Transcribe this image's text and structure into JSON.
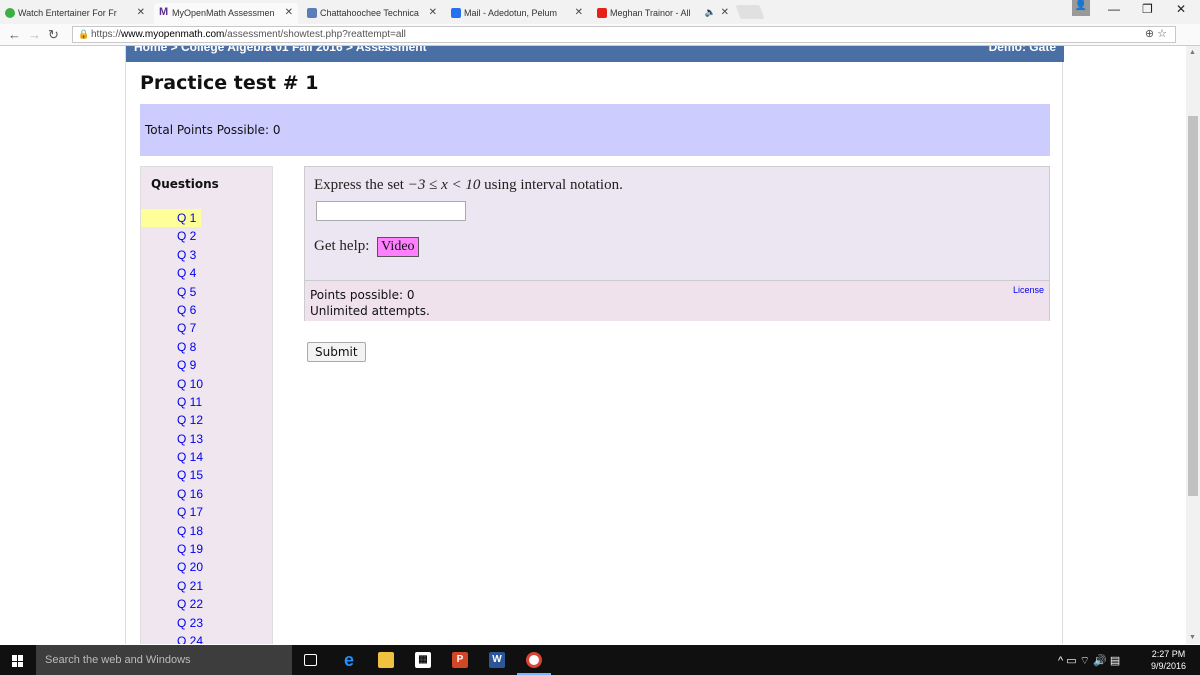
{
  "browser": {
    "tabs": [
      {
        "title": "Watch Entertainer For Fr",
        "color": "#3cb043"
      },
      {
        "title": "MyOpenMath Assessmen",
        "color": "#5c2d91"
      },
      {
        "title": "Chattahoochee Technica",
        "color": "#5b7db8"
      },
      {
        "title": "Mail - Adedotun, Pelum",
        "color": "#2672ec"
      },
      {
        "title": "Meghan Trainor - All",
        "color": "#e62117"
      }
    ],
    "url_scheme": "https://",
    "url_host": "www.myopenmath.com",
    "url_path": "/assessment/showtest.php?reattempt=all"
  },
  "header": {
    "breadcrumb": "Home > College Algebra 01 Fall 2016 > Assessment",
    "right_text": "Demo: Gate"
  },
  "page": {
    "title": "Practice test # 1",
    "total_points": "Total Points Possible: 0"
  },
  "questions_panel": {
    "heading": "Questions",
    "items": [
      "Q 1",
      "Q 2",
      "Q 3",
      "Q 4",
      "Q 5",
      "Q 6",
      "Q 7",
      "Q 8",
      "Q 9",
      "Q 10",
      "Q 11",
      "Q 12",
      "Q 13",
      "Q 14",
      "Q 15",
      "Q 16",
      "Q 17",
      "Q 18",
      "Q 19",
      "Q 20",
      "Q 21",
      "Q 22",
      "Q 23",
      "Q 24"
    ],
    "current": "Q 1"
  },
  "question": {
    "prefix": "Express the set",
    "math": "−3 ≤ x < 10",
    "suffix": "using interval notation.",
    "answer_value": "",
    "help_label": "Get help:",
    "video_label": "Video",
    "points_possible": "Points possible: 0",
    "attempts": "Unlimited attempts.",
    "license_label": "License"
  },
  "actions": {
    "submit_label": "Submit"
  },
  "taskbar": {
    "search_placeholder": "Search the web and Windows",
    "time": "2:27 PM",
    "date": "9/9/2016"
  }
}
